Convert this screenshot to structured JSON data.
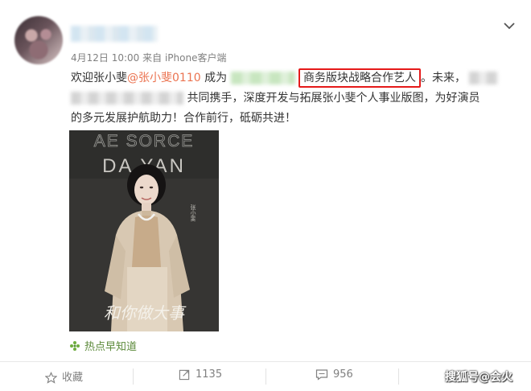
{
  "post": {
    "timestamp": "4月12日 10:00",
    "source": "来自 iPhone客户端",
    "line1": {
      "welcome": "欢迎张小斐",
      "mention": "@张小斐0110",
      "become": " 成为",
      "highlight": "商务版块战略合作艺人",
      "after": "。未来，"
    },
    "line2": {
      "text": "共同携手，深度开发与拓展张小斐个人事业版图，为好演员"
    },
    "line3": {
      "text": "的多元发展护航助力！合作前行，砥砺共进！"
    }
  },
  "photo": {
    "headline_top": "AE SORCE",
    "headline_bottom": "DA YAN",
    "vertical_name": "张小斐",
    "script_text": "和你做大事"
  },
  "topic": {
    "label": "热点早知道"
  },
  "actions": {
    "favorite": "收藏",
    "repost": "1135",
    "comment": "956"
  },
  "watermark": "搜狐号@会火",
  "colors": {
    "mention": "#eb7350",
    "highlight_border": "#e51a1a",
    "topic": "#5c8a3a",
    "meta": "#808080"
  }
}
